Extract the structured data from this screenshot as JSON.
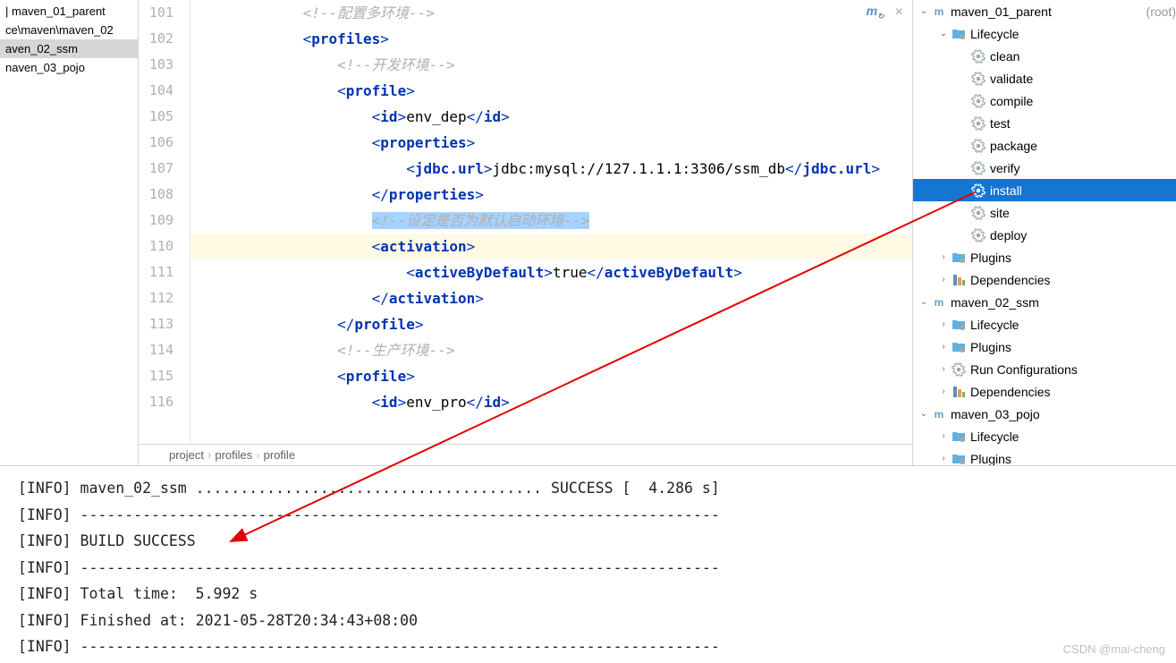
{
  "project": {
    "items": [
      {
        "label": "| maven_01_parent",
        "selected": false
      },
      {
        "label": "ce\\maven\\maven_02",
        "selected": false
      },
      {
        "label": "aven_02_ssm",
        "selected": true
      },
      {
        "label": "naven_03_pojo",
        "selected": false
      }
    ]
  },
  "editor": {
    "lines": [
      {
        "num": 101,
        "indent": "            ",
        "type": "comment",
        "text": "<!--配置多环境-->"
      },
      {
        "num": 102,
        "indent": "            ",
        "type": "tag-open",
        "tag": "profiles"
      },
      {
        "num": 103,
        "indent": "                ",
        "type": "comment",
        "text": "<!--开发环境-->"
      },
      {
        "num": 104,
        "indent": "                ",
        "type": "tag-open",
        "tag": "profile"
      },
      {
        "num": 105,
        "indent": "                    ",
        "type": "tag-line",
        "tag": "id",
        "inner": "env_dep"
      },
      {
        "num": 106,
        "indent": "                    ",
        "type": "tag-open",
        "tag": "properties"
      },
      {
        "num": 107,
        "indent": "                        ",
        "type": "tag-line",
        "tag": "jdbc.url",
        "inner": "jdbc:mysql://127.1.1.1:3306/ssm_db"
      },
      {
        "num": 108,
        "indent": "                    ",
        "type": "tag-close",
        "tag": "properties"
      },
      {
        "num": 109,
        "indent": "                    ",
        "type": "comment-selected",
        "text": "<!--设定是否为默认启动环境-->"
      },
      {
        "num": 110,
        "indent": "                    ",
        "type": "tag-open",
        "tag": "activation"
      },
      {
        "num": 111,
        "indent": "                        ",
        "type": "tag-line",
        "tag": "activeByDefault",
        "inner": "true"
      },
      {
        "num": 112,
        "indent": "                    ",
        "type": "tag-close",
        "tag": "activation"
      },
      {
        "num": 113,
        "indent": "                ",
        "type": "tag-close",
        "tag": "profile"
      },
      {
        "num": 114,
        "indent": "                ",
        "type": "comment",
        "text": "<!--生产环境-->"
      },
      {
        "num": 115,
        "indent": "                ",
        "type": "tag-open",
        "tag": "profile"
      },
      {
        "num": 116,
        "indent": "                    ",
        "type": "tag-line-partial",
        "tag": "id",
        "inner": "env_pro"
      }
    ],
    "breadcrumb": [
      "project",
      "profiles",
      "profile"
    ]
  },
  "maven": {
    "tree": [
      {
        "depth": 0,
        "toggle": "v",
        "icon": "m",
        "label": "maven_01_parent",
        "suffix": " (root)"
      },
      {
        "depth": 1,
        "toggle": "v",
        "icon": "folder",
        "label": "Lifecycle"
      },
      {
        "depth": 2,
        "toggle": "",
        "icon": "gear",
        "label": "clean"
      },
      {
        "depth": 2,
        "toggle": "",
        "icon": "gear",
        "label": "validate"
      },
      {
        "depth": 2,
        "toggle": "",
        "icon": "gear",
        "label": "compile"
      },
      {
        "depth": 2,
        "toggle": "",
        "icon": "gear",
        "label": "test"
      },
      {
        "depth": 2,
        "toggle": "",
        "icon": "gear",
        "label": "package"
      },
      {
        "depth": 2,
        "toggle": "",
        "icon": "gear",
        "label": "verify"
      },
      {
        "depth": 2,
        "toggle": "",
        "icon": "gear",
        "label": "install",
        "selected": true
      },
      {
        "depth": 2,
        "toggle": "",
        "icon": "gear",
        "label": "site"
      },
      {
        "depth": 2,
        "toggle": "",
        "icon": "gear",
        "label": "deploy"
      },
      {
        "depth": 1,
        "toggle": ">",
        "icon": "folder",
        "label": "Plugins"
      },
      {
        "depth": 1,
        "toggle": ">",
        "icon": "deps",
        "label": "Dependencies"
      },
      {
        "depth": 0,
        "toggle": "v",
        "icon": "m",
        "label": "maven_02_ssm"
      },
      {
        "depth": 1,
        "toggle": ">",
        "icon": "folder",
        "label": "Lifecycle"
      },
      {
        "depth": 1,
        "toggle": ">",
        "icon": "folder",
        "label": "Plugins"
      },
      {
        "depth": 1,
        "toggle": ">",
        "icon": "gear",
        "label": "Run Configurations"
      },
      {
        "depth": 1,
        "toggle": ">",
        "icon": "deps",
        "label": "Dependencies"
      },
      {
        "depth": 0,
        "toggle": "v",
        "icon": "m",
        "label": "maven_03_pojo"
      },
      {
        "depth": 1,
        "toggle": ">",
        "icon": "folder",
        "label": "Lifecycle"
      },
      {
        "depth": 1,
        "toggle": ">",
        "icon": "folder",
        "label": "Plugins"
      }
    ]
  },
  "console": {
    "lines": [
      "[INFO] maven_02_ssm ....................................... SUCCESS [  4.286 s]",
      "[INFO] ------------------------------------------------------------------------",
      "[INFO] BUILD SUCCESS",
      "[INFO] ------------------------------------------------------------------------",
      "[INFO] Total time:  5.992 s",
      "[INFO] Finished at: 2021-05-28T20:34:43+08:00",
      "[INFO] ------------------------------------------------------------------------"
    ]
  },
  "watermark": "CSDN @mai-cheng"
}
